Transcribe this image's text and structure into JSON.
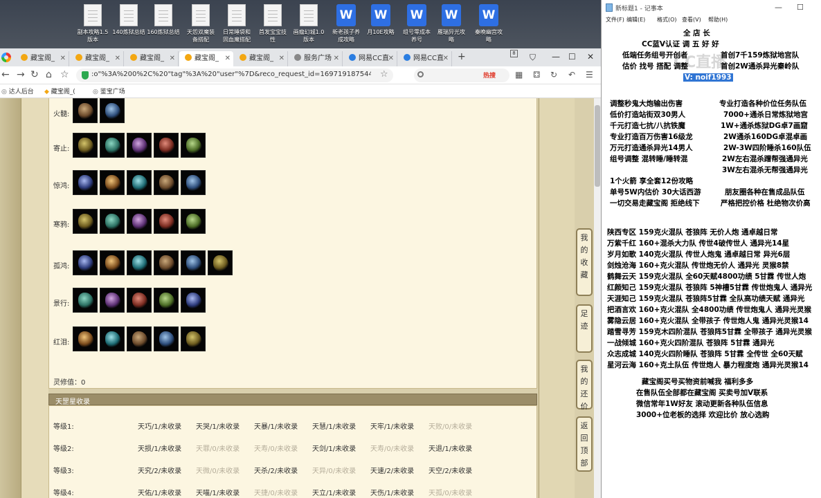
{
  "desktop": {
    "icons": [
      {
        "label": "副本攻略1.5\n版本",
        "type": "doc"
      },
      {
        "label": "140炼狱总结",
        "type": "doc"
      },
      {
        "label": "160炼狱总结",
        "type": "doc"
      },
      {
        "label": "天怨双魔装\n备搭配",
        "type": "doc"
      },
      {
        "label": "日常睡袋和\n固血魔搭配",
        "type": "doc"
      },
      {
        "label": "首发宝宝技\n性",
        "type": "doc"
      },
      {
        "label": "画瘤幻城1.0\n版本",
        "type": "doc"
      },
      {
        "label": "新老孩子养\n成攻略",
        "type": "wps"
      },
      {
        "label": "月10E攻略",
        "type": "wps"
      },
      {
        "label": "组号零成本\n养号",
        "type": "wps"
      },
      {
        "label": "雁瑞异光攻\n略",
        "type": "wps"
      },
      {
        "label": "秦晚幽宫攻\n略",
        "type": "wps"
      }
    ],
    "wps_glyph": "W"
  },
  "browser": {
    "tabs": [
      {
        "label": "藏宝阁_",
        "fav": "#f3a712"
      },
      {
        "label": "藏宝阁_",
        "fav": "#f3a712"
      },
      {
        "label": "藏宝阁_",
        "fav": "#f3a712"
      },
      {
        "label": "藏宝阁_",
        "fav": "#f3a712",
        "active": true
      },
      {
        "label": "藏宝阁_",
        "fav": "#f3a712"
      },
      {
        "label": "服务广场",
        "fav": "#888888"
      },
      {
        "label": "网易CC直",
        "fav": "#2a7de1"
      },
      {
        "label": "网易CC直",
        "fav": "#2a7de1"
      }
    ],
    "tab_count": "8",
    "url": ":o\"%3A%200%2C%20\"tag\"%3A%20\"user\"%7D&reco_request_id=1697191875444PDcQu",
    "hot_label": "热搜",
    "bookmarks": [
      "达人后台",
      "藏宝阁_(",
      "鉴宝广场"
    ]
  },
  "panel1": {
    "rows": [
      {
        "label": "火髓:",
        "count": 2
      },
      {
        "label": "寄止:",
        "count": 5
      },
      {
        "label": "惊鸿:",
        "count": 5
      },
      {
        "label": "寒鸦:",
        "count": 5
      },
      {
        "label": "孤鸿:",
        "count": 6
      },
      {
        "label": "景行:",
        "count": 5
      },
      {
        "label": "红泪:",
        "count": 5
      }
    ],
    "lingxiu": "灵修值：0"
  },
  "panel2": {
    "title": "天罡星收录",
    "rows": [
      {
        "level": "等级1:",
        "entries": [
          {
            "t": "天巧/1/未收录",
            "dim": false
          },
          {
            "t": "天哭/1/未收录",
            "dim": false
          },
          {
            "t": "天暴/1/未收录",
            "dim": false
          },
          {
            "t": "天慧/1/未收录",
            "dim": false
          },
          {
            "t": "天牢/1/未收录",
            "dim": false
          },
          {
            "t": "天败/0/未收录",
            "dim": true
          }
        ]
      },
      {
        "level": "等级2:",
        "entries": [
          {
            "t": "天损/1/未收录",
            "dim": false
          },
          {
            "t": "天罪/0/未收录",
            "dim": true
          },
          {
            "t": "天寿/0/未收录",
            "dim": true
          },
          {
            "t": "天剑/1/未收录",
            "dim": false
          },
          {
            "t": "天寿/0/未收录",
            "dim": true
          },
          {
            "t": "天退/1/未收录",
            "dim": false
          }
        ]
      },
      {
        "level": "等级3:",
        "entries": [
          {
            "t": "天究/2/未收录",
            "dim": false
          },
          {
            "t": "天微/0/未收录",
            "dim": true
          },
          {
            "t": "天杀/2/未收录",
            "dim": false
          },
          {
            "t": "天异/0/未收录",
            "dim": true
          },
          {
            "t": "天速/2/未收录",
            "dim": false
          },
          {
            "t": "天空/2/未收录",
            "dim": false
          }
        ]
      },
      {
        "level": "等级4:",
        "entries": [
          {
            "t": "天佑/1/未收录",
            "dim": false
          },
          {
            "t": "天喵/1/未收录",
            "dim": false
          },
          {
            "t": "天捷/0/未收录",
            "dim": true
          },
          {
            "t": "天立/1/未收录",
            "dim": false
          },
          {
            "t": "天伤/1/未收录",
            "dim": false
          },
          {
            "t": "天孤/0/未收录",
            "dim": true
          }
        ]
      }
    ]
  },
  "side_buttons": [
    {
      "label": "我的收藏"
    },
    {
      "label": "足迹"
    },
    {
      "label": "我的还价"
    },
    {
      "label": "返回顶部"
    }
  ],
  "notepad": {
    "title": "新标题1 - 记事本",
    "menus": [
      "文件(F)",
      "编辑(E)",
      "格式(O)",
      "查看(V)",
      "帮助(H)"
    ],
    "watermark": "CC直播",
    "lines": [
      {
        "t": "全 店 长"
      },
      {
        "t": "CC蓝V认证 调 五 好 好"
      },
      {
        "t": "低端任务组号开创者"
      },
      {
        "t": "首创7千159炼狱地宫队"
      },
      {
        "t": "估价 找号 搭配 调整"
      },
      {
        "t": "首创2W通杀异光秦岭队"
      },
      {
        "t": "V: noif1993",
        "sel": true
      },
      {
        "t": "调整秒鬼大炮输出伤害"
      },
      {
        "t": "专业打造各种价位任务队伍"
      },
      {
        "t": "低价打造站街双30男人"
      },
      {
        "t": "7000+通杀日常炼狱地宫"
      },
      {
        "t": "千元打造七抗/八抗铁魔"
      },
      {
        "t": "1W+通杀炼狱DG卓7画窟"
      },
      {
        "t": "专业打造百万伤害16级龙"
      },
      {
        "t": "2W通杀160DG卓混卓画"
      },
      {
        "t": "万元打造通杀异光14男人"
      },
      {
        "t": "2W-3W四阶睡杀160队伍"
      },
      {
        "t": "组号调整 混转睡/睡转混"
      },
      {
        "t": "2W左右混杀蹭帮强通异光"
      },
      {
        "t": "3W左右混杀无帮强通异光"
      },
      {
        "t": "1个火箭 享全套12份攻略"
      },
      {
        "t": "单号5W内估价 30大话西游"
      },
      {
        "t": "朋友圈各种在售成品队伍"
      },
      {
        "t": "一切交易走藏宝阁 拒绝线下"
      },
      {
        "t": "严格把控价格 杜绝物次价高"
      },
      {
        "t": "陕西专区 159克火混队 苍狼阵 无价人炮 通卓越日常"
      },
      {
        "t": "万紫千红 160+混杀大力队 传世4破传世人 通异光14星"
      },
      {
        "t": "岁月如歌 140克火混队 传世人炮鬼 通卓越日常 异光6层"
      },
      {
        "t": "剑烛沧海 160+克火混队 传世炮无价人 通异光 灵猴8禁"
      },
      {
        "t": "鹤舞云天 159克火混队 全60天赋4800功绩 5甘霖 传世人炮"
      },
      {
        "t": "红颜知己 159克火混队 苍狼阵 5神槽5甘霖 传世炮鬼人 通异光"
      },
      {
        "t": "天涯知己 159克火混队 苍狼阵5甘霖 全队高功绩天赋 通异光"
      },
      {
        "t": "把酒言欢 160+克火混队 全4800功绩 传世炮鬼人 通异光灵猴"
      },
      {
        "t": "雾隐云居 160+克火混队 全带孩子 传世炮人鬼 通异光灵猴14"
      },
      {
        "t": "踏雪寻芳 159克木四阶混队 苍狼阵5甘霖 全带孩子 通异光灵猴"
      },
      {
        "t": "一战倾城 160+克火四阶混队 苍狼阵 5甘霖 通异光"
      },
      {
        "t": "众志成城 140克火四阶睡队 苍狼阵 5甘霖 全传世 全60天赋"
      },
      {
        "t": "星河云海 160+克土队伍 传世炮人 暴力程度炮 通异光灵猴14"
      },
      {
        "t": "藏宝阁买号买物资前喊我 福利多多"
      },
      {
        "t": "在售队伍全部都在藏宝阁 买卖号加V联系"
      },
      {
        "t": "微信常年1W好友 滚动更新各种队伍信息"
      },
      {
        "t": "3000+位老板的选择 欢迎比价 放心选购"
      }
    ]
  },
  "colors": {
    "page_bg": "#d9cfac",
    "panel_bg": "#fcf6e1",
    "panel_header": "#9b8d68",
    "selection": "#3075d4"
  }
}
